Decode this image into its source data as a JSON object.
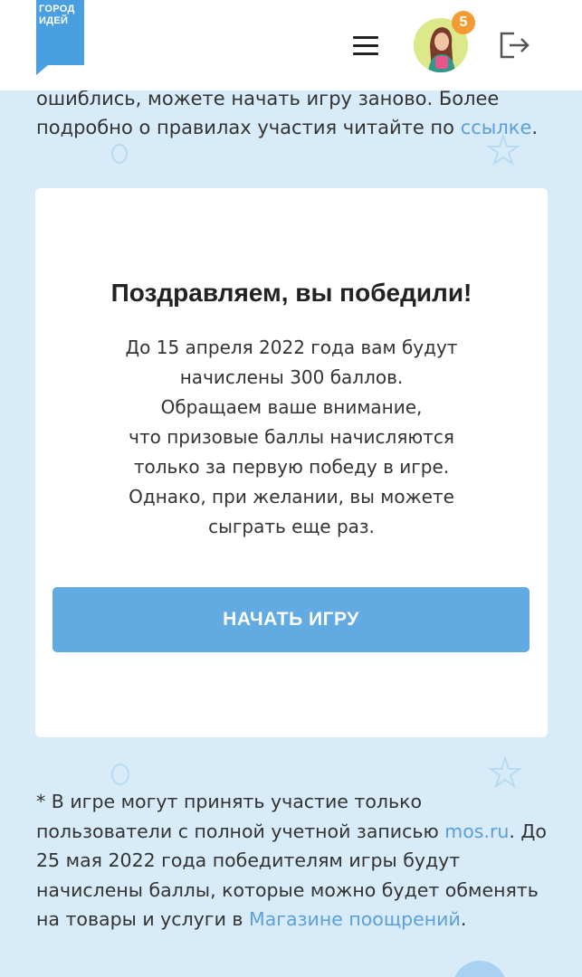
{
  "header": {
    "logo_line1": "ГОРОД",
    "logo_line2": "ИДЕЙ",
    "notification_count": "5",
    "menu_icon": "hamburger-icon",
    "logout_icon": "logout-icon"
  },
  "intro": {
    "text_before_link": "ошиблись, можете начать игру заново. Более подробно о правилах участия читайте по ",
    "link_text": "ссылке",
    "text_after_link": "."
  },
  "card": {
    "title": "Поздравляем, вы победили!",
    "body_lines": [
      "До 15 апреля 2022 года вам будут",
      "начислены 300 баллов.",
      "Обращаем ваше внимание,",
      "что призовые баллы начисляются",
      "только за первую победу в игре.",
      "Однако, при желании, вы можете",
      "сыграть еще раз."
    ],
    "button_label": "НАЧАТЬ ИГРУ"
  },
  "footer_note": {
    "part1": "* В игре могут принять участие только пользователи с полной учетной записью ",
    "link1": "mos.ru",
    "part2": ". До 25 мая 2022 года победителям игры будут начислены баллы, которые можно будет обменять на товары и услуги в ",
    "link2": "Магазине поощрений",
    "part3": "."
  },
  "colors": {
    "background": "#d7ebf8",
    "accent": "#62aae2",
    "link": "#5b9fdc",
    "badge": "#f39a32",
    "logo": "#4a9fe0"
  }
}
